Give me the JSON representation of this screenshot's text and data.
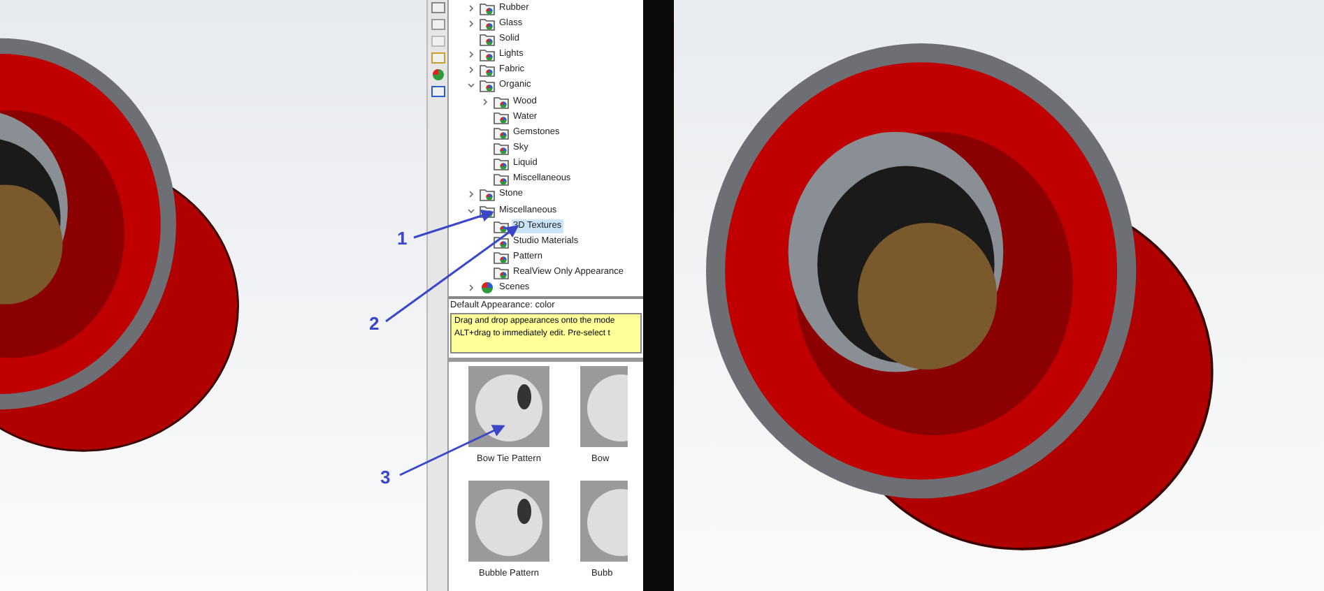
{
  "tree": [
    {
      "label": "Rubber",
      "expanded": false,
      "selected": false
    },
    {
      "label": "Glass",
      "expanded": false,
      "selected": false
    },
    {
      "label": "Solid",
      "selected": false
    },
    {
      "label": "Lights",
      "expanded": false,
      "selected": false
    },
    {
      "label": "Fabric",
      "expanded": false,
      "selected": false
    },
    {
      "label": "Organic",
      "expanded": true,
      "selected": false,
      "children": [
        {
          "label": "Wood",
          "expanded": false,
          "selected": false
        },
        {
          "label": "Water",
          "selected": false
        },
        {
          "label": "Gemstones",
          "selected": false
        },
        {
          "label": "Sky",
          "selected": false
        },
        {
          "label": "Liquid",
          "selected": false
        },
        {
          "label": "Miscellaneous",
          "selected": false
        }
      ]
    },
    {
      "label": "Stone",
      "expanded": false,
      "selected": false
    },
    {
      "label": "Miscellaneous",
      "expanded": true,
      "selected": false,
      "children": [
        {
          "label": "3D Textures",
          "selected": true
        },
        {
          "label": "Studio Materials",
          "selected": false
        },
        {
          "label": "Pattern",
          "selected": false
        },
        {
          "label": "RealView Only Appearance",
          "selected": false
        }
      ]
    },
    {
      "label": "Scenes",
      "kind": "scenes",
      "expanded": false,
      "selected": false
    }
  ],
  "appearance_label": "Default Appearance: color",
  "hint_lines": [
    "Drag and drop appearances onto the mode",
    "ALT+drag to immediately edit.  Pre-select t"
  ],
  "thumbnails": [
    {
      "label": "Bow Tie Pattern"
    },
    {
      "label": "Bow"
    },
    {
      "label": "Bubble Pattern"
    },
    {
      "label": "Bubb"
    }
  ],
  "annotations": [
    {
      "label": "1"
    },
    {
      "label": "2"
    },
    {
      "label": "3"
    }
  ]
}
